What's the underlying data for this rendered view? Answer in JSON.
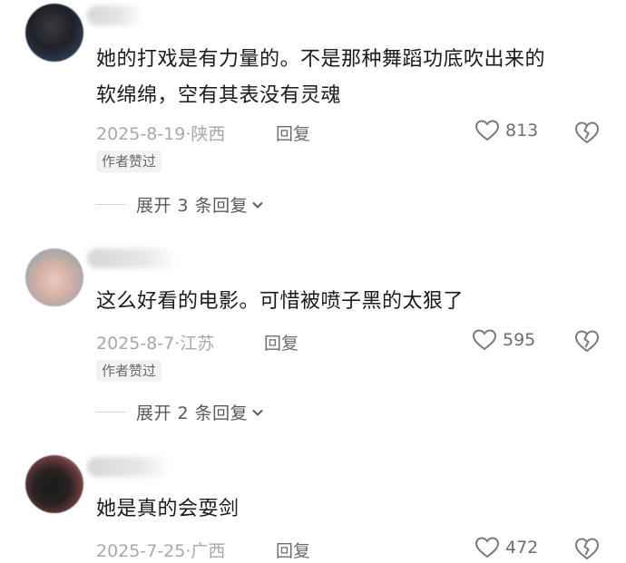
{
  "comments": [
    {
      "text_line1": "她的打戏是有力量的。不是那种舞蹈功底吹出来的",
      "text_line2": "软绵绵，空有其表没有灵魂",
      "date_location": "2025-8-19·陕西",
      "reply_label": "回复",
      "likes": "813",
      "badge": "作者赞过",
      "expand_label": "展开 3 条回复"
    },
    {
      "text_line1": "这么好看的电影。可惜被喷子黑的太狠了",
      "date_location": "2025-8-7·江苏",
      "reply_label": "回复",
      "likes": "595",
      "badge": "作者赞过",
      "expand_label": "展开 2 条回复"
    },
    {
      "text_line1": "她是真的会耍剑",
      "date_location": "2025-7-25·广西",
      "reply_label": "回复",
      "likes": "472"
    }
  ],
  "icons": {
    "like": "heart-outline-icon",
    "dislike": "broken-heart-icon",
    "expand": "chevron-down-icon"
  },
  "colors": {
    "text": "#1a1a1a",
    "meta": "#a9a9a9",
    "action": "#6e6e6e"
  }
}
